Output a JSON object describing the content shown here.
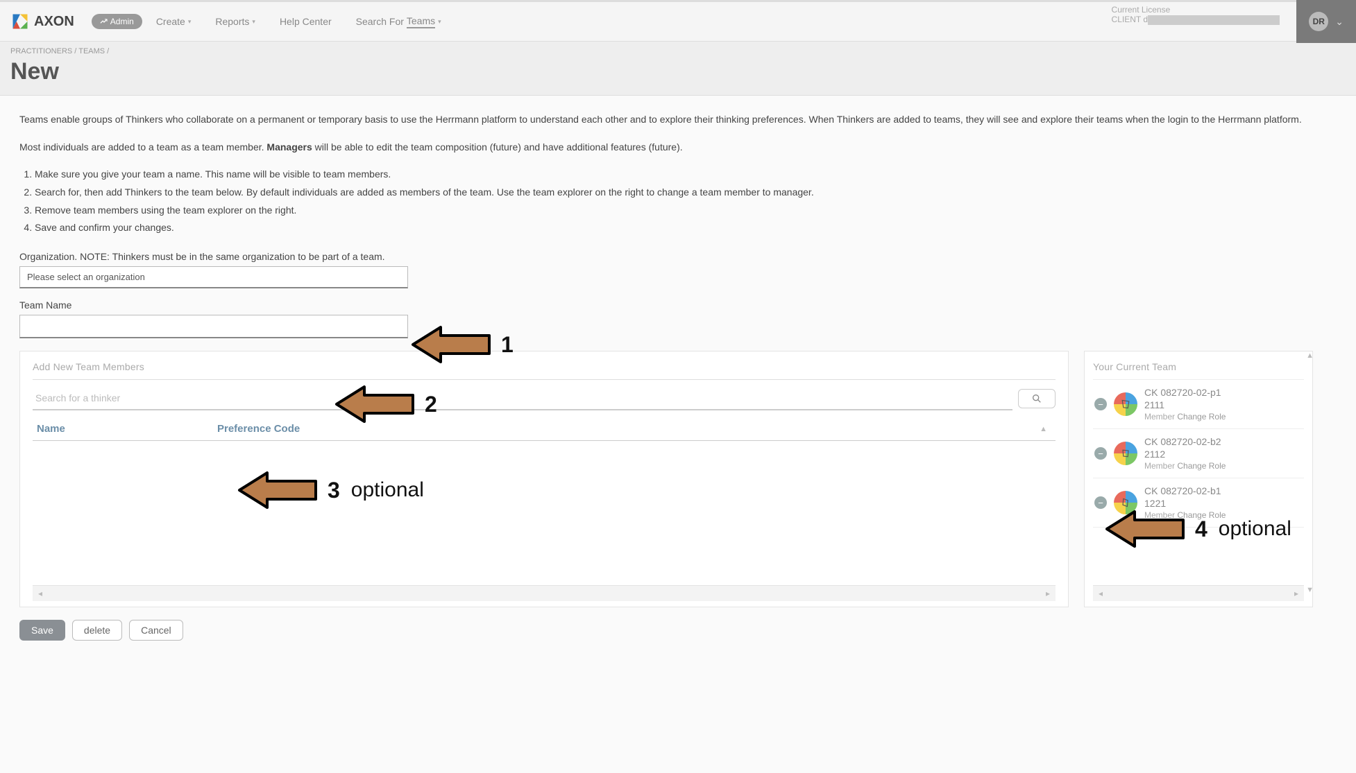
{
  "header": {
    "brand": "AXON",
    "admin_badge": "Admin",
    "nav": {
      "create": "Create",
      "reports": "Reports",
      "help": "Help Center",
      "search_prefix": "Search For ",
      "search_target": "Teams"
    },
    "license_label": "Current License",
    "license_client_prefix": "CLIENT d",
    "user_initials": "DR"
  },
  "breadcrumb": {
    "practitioners": "PRACTITIONERS",
    "teams": "TEAMS"
  },
  "page_title": "New",
  "intro": {
    "p1": "Teams enable groups of Thinkers who collaborate on a permanent or temporary basis to use the Herrmann platform to understand each other and to explore their thinking preferences. When Thinkers are added to teams, they will see and explore their teams when the login to the Herrmann platform.",
    "p2a": "Most individuals are added to a team as a team member. ",
    "p2b_bold": "Managers",
    "p2c": " will be able to edit the team composition (future) and have additional features (future).",
    "steps": [
      "Make sure you give your team a name. This name will be visible to team members.",
      "Search for, then add Thinkers to the team below. By default individuals are added as members of the team. Use the team explorer on the right to change a team member to manager.",
      "Remove team members using the team explorer on the right.",
      "Save and confirm your changes."
    ]
  },
  "org": {
    "label": "Organization. NOTE: Thinkers must be in the same organization to be part of a team.",
    "placeholder": "Please select an organization"
  },
  "team_name": {
    "label": "Team Name",
    "value": ""
  },
  "left_panel": {
    "title": "Add New Team Members",
    "search_placeholder": "Search for a thinker",
    "col_name": "Name",
    "col_pref": "Preference Code"
  },
  "right_panel": {
    "title": "Your Current Team",
    "role_label": "Member",
    "change_role": "Change Role",
    "members": [
      {
        "name": "CK 082720-02-p1",
        "code": "2111"
      },
      {
        "name": "CK 082720-02-b2",
        "code": "2112"
      },
      {
        "name": "CK 082720-02-b1",
        "code": "1221"
      }
    ]
  },
  "actions": {
    "save": "Save",
    "delete": "delete",
    "cancel": "Cancel"
  },
  "annotations": {
    "a1": "1",
    "a2": "2",
    "a3": "3",
    "a3_sub": "optional",
    "a4": "4",
    "a4_sub": "optional"
  }
}
